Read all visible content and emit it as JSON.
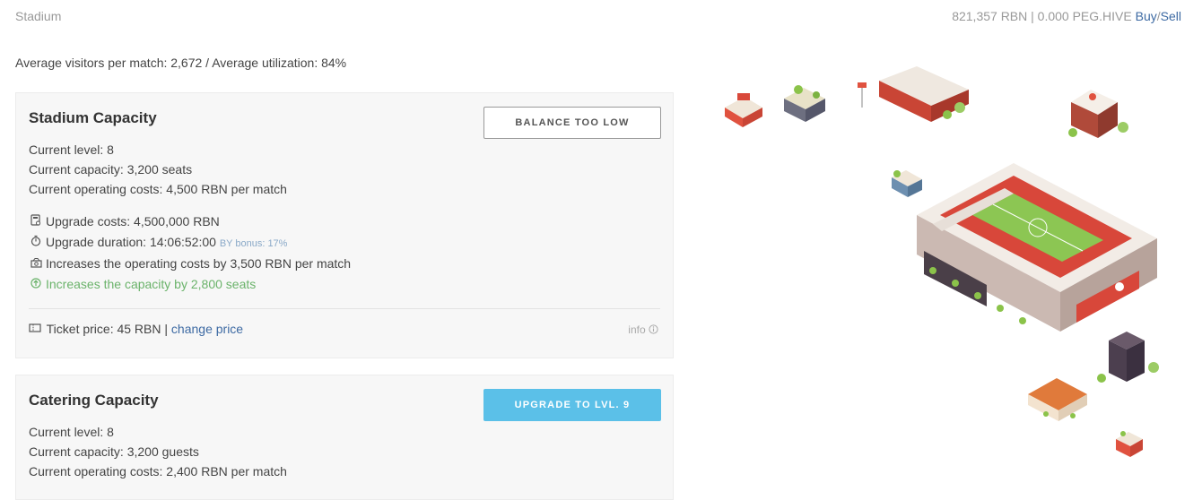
{
  "header": {
    "title": "Stadium",
    "balance": "821,357 RBN | 0.000 PEG.HIVE",
    "buy_label": "Buy",
    "separator": "/",
    "sell_label": "Sell"
  },
  "summary": "Average visitors per match: 2,672 / Average utilization: 84%",
  "stadium_capacity": {
    "title": "Stadium Capacity",
    "button_label": "BALANCE TOO LOW",
    "current_level": "Current level: 8",
    "current_capacity": "Current capacity: 3,200 seats",
    "current_costs": "Current operating costs: 4,500 RBN per match",
    "upgrade_costs": "Upgrade costs: 4,500,000 RBN",
    "upgrade_duration": "Upgrade duration: 14:06:52:00",
    "bonus": "BY bonus: 17%",
    "cost_increase": "Increases the operating costs by 3,500 RBN per match",
    "capacity_increase": "Increases the capacity by 2,800 seats",
    "ticket_price": "Ticket price: 45 RBN |",
    "change_price_label": "change price",
    "info_label": "info"
  },
  "catering_capacity": {
    "title": "Catering Capacity",
    "button_label": "UPGRADE TO LVL. 9",
    "current_level": "Current level: 8",
    "current_capacity": "Current capacity: 3,200 guests",
    "current_costs": "Current operating costs: 2,400 RBN per match"
  },
  "icons": [
    "calculator-icon",
    "stopwatch-icon",
    "cash-icon",
    "arrow-up-circle-icon",
    "ticket-icon",
    "info-icon"
  ],
  "colors": {
    "link": "#3d6aa3",
    "primary_button": "#5bc0e8",
    "positive": "#6bb36b",
    "card_bg": "#f7f7f7"
  }
}
